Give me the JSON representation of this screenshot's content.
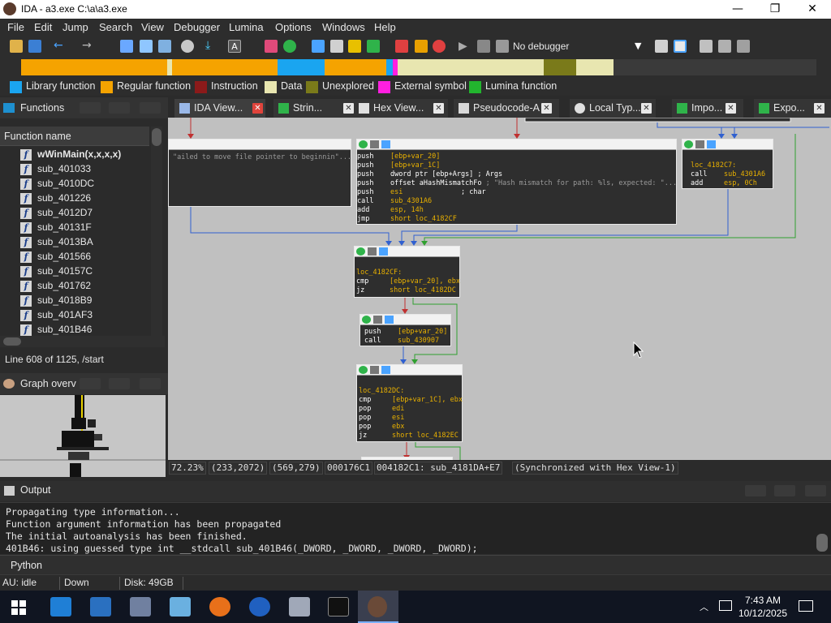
{
  "window": {
    "title": "IDA - a3.exe C:\\a\\a3.exe",
    "minimize_icon": "minimize-icon",
    "maximize_icon": "maximize-icon",
    "close_icon": "close-icon",
    "minimize_glyph": "—",
    "maximize_glyph": "❐",
    "close_glyph": "✕"
  },
  "menu": [
    "File",
    "Edit",
    "Jump",
    "Search",
    "View",
    "Debugger",
    "Lumina",
    "Options",
    "Windows",
    "Help"
  ],
  "toolbar": {
    "debugger_select": "No debugger"
  },
  "legend": [
    {
      "label": "Library function",
      "color": "#1aa5f0"
    },
    {
      "label": "Regular function",
      "color": "#f5a300"
    },
    {
      "label": "Instruction",
      "color": "#8b1a1a"
    },
    {
      "label": "Data",
      "color": "#e8e6b0"
    },
    {
      "label": "Unexplored",
      "color": "#7a7a1a"
    },
    {
      "label": "External symbol",
      "color": "#ff1fe0"
    },
    {
      "label": "Lumina function",
      "color": "#22b52e"
    }
  ],
  "functions_panel": {
    "title": "Functions",
    "column_header": "Function name",
    "rows": [
      "wWinMain(x,x,x,x)",
      "sub_401033",
      "sub_4010DC",
      "sub_401226",
      "sub_4012D7",
      "sub_40131F",
      "sub_4013BA",
      "sub_401566",
      "sub_40157C",
      "sub_401762",
      "sub_4018B9",
      "sub_401AF3",
      "sub_401B46"
    ],
    "line_info": "Line 608 of 1125, /start"
  },
  "graph_overview": {
    "title": "Graph overv"
  },
  "tabs": [
    {
      "label": "IDA View...",
      "icon": "ida-view-icon"
    },
    {
      "label": "Strin...",
      "icon": "strings-icon"
    },
    {
      "label": "Hex View...",
      "icon": "hex-view-icon"
    },
    {
      "label": "Pseudocode-A",
      "icon": "pseudocode-icon"
    },
    {
      "label": "Local Typ...",
      "icon": "local-types-icon"
    },
    {
      "label": "Impo...",
      "icon": "imports-icon"
    },
    {
      "label": "Expo...",
      "icon": "exports-icon"
    }
  ],
  "graph": {
    "block_left_comment": "\"ailed to move file pointer to beginnin\"...",
    "block_main": [
      [
        "push",
        "[ebp+var_20]",
        ""
      ],
      [
        "push",
        "[ebp+var_1C]",
        ""
      ],
      [
        "push",
        "dword ptr [ebp+Args]",
        " ; Args"
      ],
      [
        "push",
        "offset aHashMismatchFo",
        " ; \"Hash mismatch for path: %ls, expected: \"..."
      ],
      [
        "push",
        "esi",
        "              ; char"
      ],
      [
        "call",
        "sub_4301A6",
        ""
      ],
      [
        "add",
        "esp, 14h",
        ""
      ],
      [
        "jmp",
        "short loc_4182CF",
        ""
      ]
    ],
    "block_right": {
      "label": "loc_4182C7:",
      "lines": [
        [
          "call",
          "sub_4301A6"
        ],
        [
          "add",
          "esp, 0Ch"
        ]
      ]
    },
    "block_cf": {
      "label": "loc_4182CF:",
      "lines": [
        [
          "cmp",
          "[ebp+var_20], ebx"
        ],
        [
          "jz",
          "short loc_4182DC"
        ]
      ]
    },
    "block_mid": {
      "lines": [
        [
          "push",
          "[ebp+var_20]"
        ],
        [
          "call",
          "sub_430907"
        ]
      ]
    },
    "block_dc": {
      "label": "loc_4182DC:",
      "lines": [
        [
          "cmp",
          "[ebp+var_1C], ebx"
        ],
        [
          "pop",
          "edi"
        ],
        [
          "pop",
          "esi"
        ],
        [
          "pop",
          "ebx"
        ],
        [
          "jz",
          "short loc_4182EC"
        ]
      ]
    }
  },
  "statusline": [
    "72.23%",
    "(233,2072)",
    "(569,279)",
    "000176C1",
    "004182C1: sub_4181DA+E7",
    "(Synchronized with Hex View-1)"
  ],
  "output": {
    "title": "Output",
    "lines": [
      "Propagating type information...",
      "Function argument information has been propagated",
      "The initial autoanalysis has been finished.",
      "401B46: using guessed type int __stdcall sub_401B46(_DWORD, _DWORD, _DWORD, _DWORD);"
    ]
  },
  "python_label": "Python",
  "status": {
    "au": "AU:  idle",
    "dir": "Down",
    "disk": "Disk: 49GB"
  },
  "clock": {
    "time": "7:43 AM",
    "date": "10/12/2025"
  }
}
